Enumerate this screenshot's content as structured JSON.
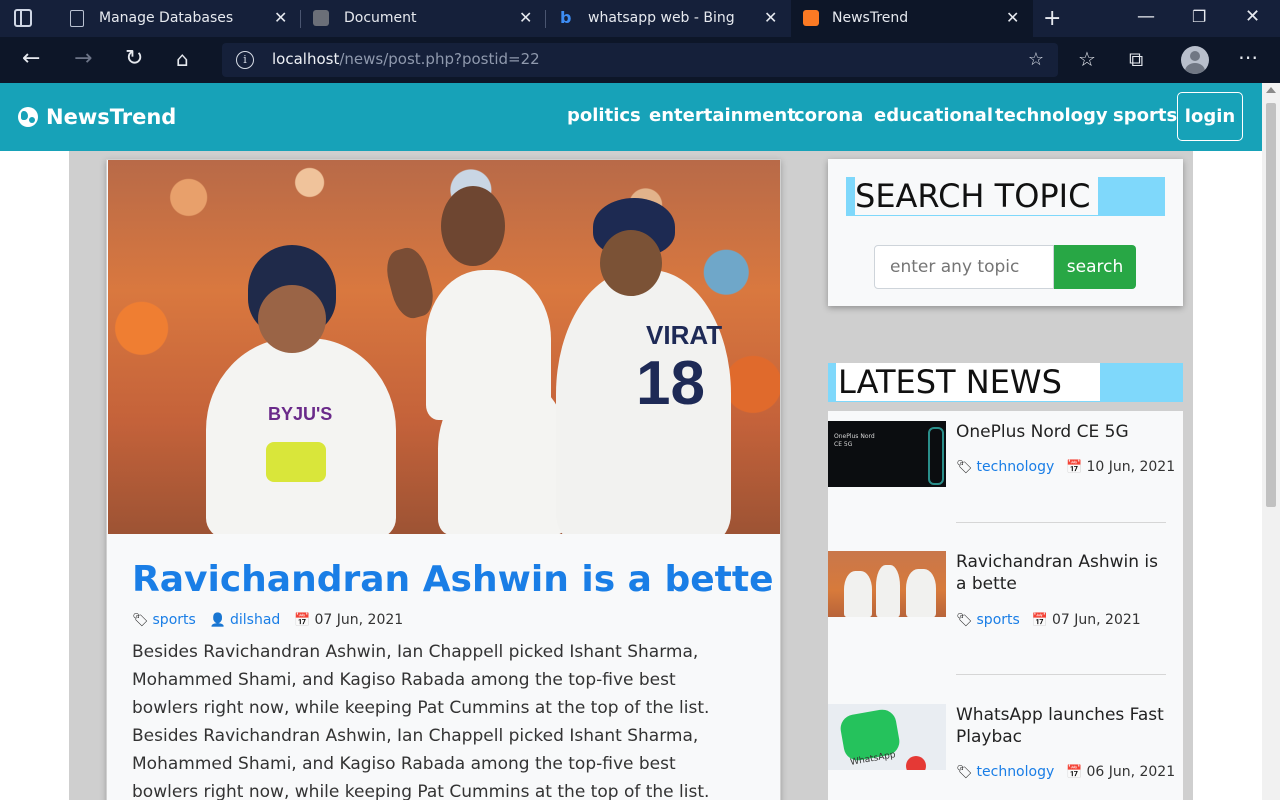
{
  "browser": {
    "tabs": [
      {
        "title": "Manage Databases",
        "active": false
      },
      {
        "title": "Document",
        "active": false
      },
      {
        "title": "whatsapp web - Bing",
        "active": false
      },
      {
        "title": "NewsTrend",
        "active": true
      }
    ],
    "address": {
      "host": "localhost",
      "path": "/news/post.php?postid=22"
    }
  },
  "site": {
    "brand": "NewsTrend",
    "nav": [
      "politics",
      "entertainment",
      "corona",
      "educational",
      "technology",
      "sports"
    ],
    "login_label": "login"
  },
  "article": {
    "title": "Ravichandran Ashwin is a bette",
    "category": "sports",
    "author": "dilshad",
    "date": "07 Jun, 2021",
    "body": "Besides Ravichandran Ashwin, Ian Chappell picked Ishant Sharma, Mohammed Shami, and Kagiso Rabada among the top-five best bowlers right now, while keeping Pat Cummins at the top of the list. Besides Ravichandran Ashwin, Ian Chappell picked Ishant Sharma, Mohammed Shami, and Kagiso Rabada among the top-five best bowlers right now, while keeping Pat Cummins at the top of the list. Besides Ravichandran",
    "image_text": {
      "jersey_name": "VIRAT",
      "jersey_number": "18",
      "sponsor": "BYJU'S"
    }
  },
  "sidebar": {
    "search_heading": "SEARCH TOPIC",
    "search_placeholder": "enter any topic",
    "search_button": "search",
    "latest_heading": "LATEST NEWS",
    "latest": [
      {
        "title": "OnePlus Nord CE 5G",
        "category": "technology",
        "date": "10 Jun, 2021",
        "thumb_text": "OnePlus Nord CE 5G"
      },
      {
        "title": "Ravichandran Ashwin is a bette",
        "category": "sports",
        "date": "07 Jun, 2021"
      },
      {
        "title": "WhatsApp launches Fast Playbac",
        "category": "technology",
        "date": "06 Jun, 2021",
        "thumb_text": "WhatsApp"
      }
    ]
  },
  "colors": {
    "navbar": "#17a2b8",
    "link": "#1a7ee6",
    "search_button": "#28a745",
    "heading_accent": "#7fd8fb"
  }
}
